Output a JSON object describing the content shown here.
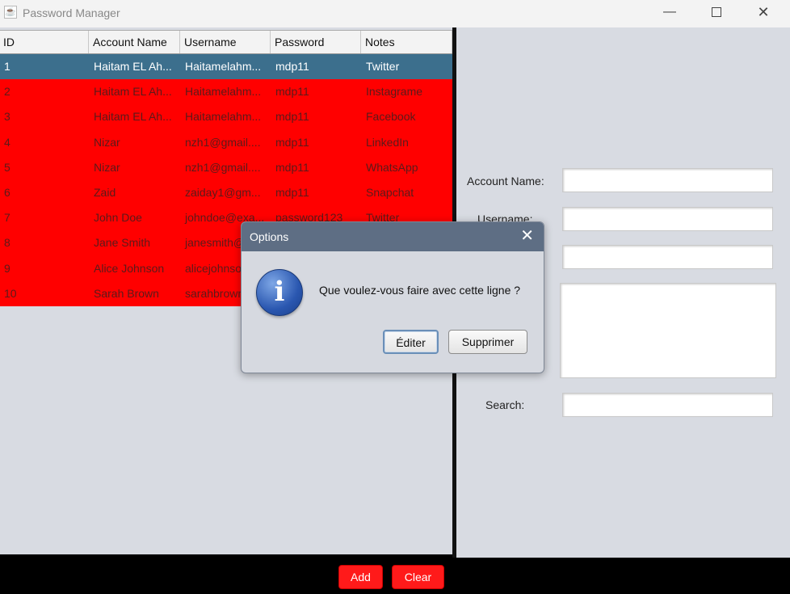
{
  "window": {
    "title": "Password Manager",
    "app_icon": "java-cup-icon",
    "minimize": "—",
    "close": "✕"
  },
  "table": {
    "columns": [
      "ID",
      "Account Name",
      "Username",
      "Password",
      "Notes"
    ],
    "rows": [
      [
        "1",
        "Haitam EL Ah...",
        "Haitamelahm...",
        "mdp11",
        "Twitter"
      ],
      [
        "2",
        "Haitam EL Ah...",
        "Haitamelahm...",
        "mdp11",
        "Instagrame"
      ],
      [
        "3",
        "Haitam EL Ah...",
        "Haitamelahm...",
        "mdp11",
        "Facebook"
      ],
      [
        "4",
        "Nizar",
        "nzh1@gmail....",
        "mdp11",
        "LinkedIn"
      ],
      [
        "5",
        "Nizar",
        "nzh1@gmail....",
        "mdp11",
        "WhatsApp"
      ],
      [
        "6",
        "Zaid",
        "zaiday1@gm...",
        "mdp11",
        "Snapchat"
      ],
      [
        "7",
        "John Doe",
        "johndoe@exa...",
        "password123",
        "Twitter"
      ],
      [
        "8",
        "Jane Smith",
        "janesmith@...",
        "",
        ""
      ],
      [
        "9",
        "Alice Johnson",
        "alicejohnson...",
        "",
        ""
      ],
      [
        "10",
        "Sarah Brown",
        "sarahbrown...",
        "",
        ""
      ]
    ],
    "selected_row": 0,
    "colors": {
      "row_bg": "#ff0000",
      "selected_bg": "#3c6f8d"
    }
  },
  "form": {
    "account_name_label": "Account Name:",
    "username_label": "Username:",
    "search_label": "Search:"
  },
  "buttons": {
    "add": "Add",
    "clear": "Clear"
  },
  "dialog": {
    "title": "Options",
    "close": "✕",
    "icon": "information-icon",
    "icon_glyph": "i",
    "message": "Que voulez-vous faire avec cette ligne ?",
    "edit_label": "Éditer",
    "delete_label": "Supprimer"
  }
}
